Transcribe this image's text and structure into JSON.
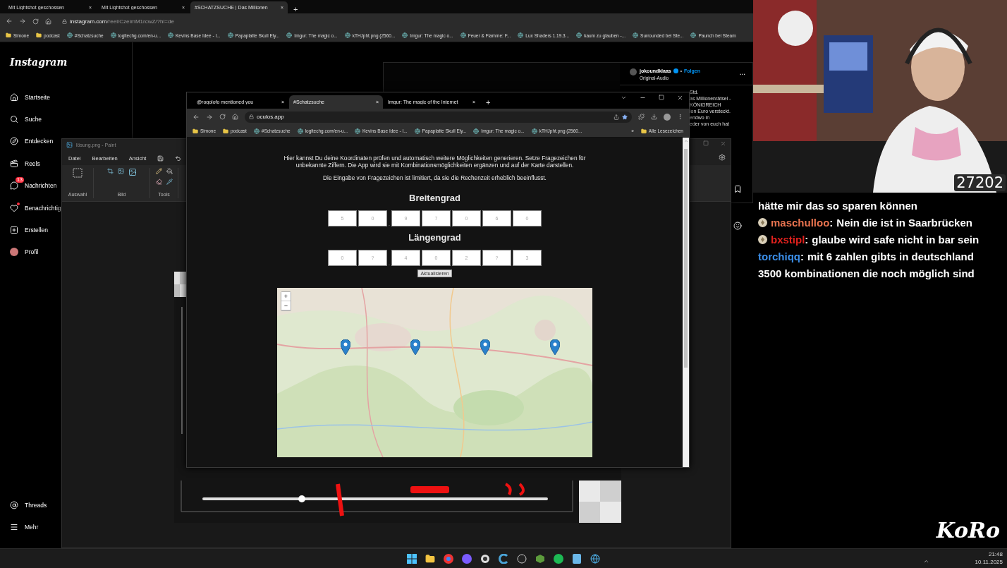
{
  "browser": {
    "tabs": [
      {
        "label": "Mit Lightshot geschossen",
        "close": "×",
        "selected": false
      },
      {
        "label": "Mit Lightshot geschossen",
        "close": "×",
        "selected": false
      },
      {
        "label": "#SCHATZSUCHE | Das Millionen",
        "close": "×",
        "selected": true
      }
    ],
    "new_tab": "+",
    "url_host": "instagram.com",
    "url_path": "/reel/CzeimM1rcwZ/?hl=de",
    "bookmarks": [
      "Simone",
      "podcast",
      "#Schatzsuche",
      "logitechg.com/en-u...",
      "Kevins Base Idee - I...",
      "Papaplatte Skull Ely...",
      "Imgur: The magic o...",
      "kTHJpht.png (2560...",
      "Imgur: The magic o...",
      "Feuer & Flamme: F...",
      "Lux Shaders 1.19.3...",
      "kaum zu glauben -...",
      "Surrounded bei Ste...",
      "Paunch bei Steam"
    ]
  },
  "instagram": {
    "logo": "Instagram",
    "nav": [
      {
        "label": "Startseite"
      },
      {
        "label": "Suche"
      },
      {
        "label": "Entdecken"
      },
      {
        "label": "Reels"
      },
      {
        "label": "Nachrichten",
        "badge": "13"
      },
      {
        "label": "Benachrichtig",
        "dot": true
      },
      {
        "label": "Erstellen"
      },
      {
        "label": "Profil"
      }
    ],
    "nav_bottom": [
      {
        "label": "Threads"
      },
      {
        "label": "Mehr"
      }
    ],
    "post": {
      "account": "jokoundklaas",
      "separator": "•",
      "follow": "Folgen",
      "audio": "Original-Audio",
      "more": "...",
      "caption_lines": [
        "Std.",
        "as Millionenrätsel -",
        "KÖNIGREICH",
        "ion Euro versteckt.",
        "endwo in",
        "eder von euch hat"
      ]
    }
  },
  "paint": {
    "title": "lösung.png - Paint",
    "menu": [
      "Datei",
      "Bearbeiten",
      "Ansicht"
    ],
    "groups": [
      "Auswahl",
      "Bild",
      "Tools"
    ]
  },
  "inner_browser": {
    "tabs": [
      {
        "label": "@rogolofo mentioned you",
        "close": "×",
        "selected": false
      },
      {
        "label": "#Schatzsuche",
        "close": "×",
        "selected": true
      },
      {
        "label": "Imgur: The magic of the Internet",
        "close": "×",
        "selected": false
      }
    ],
    "new_tab": "+",
    "url": "oculos.app",
    "bookmarks": [
      "Simone",
      "podcast",
      "#Schatzsuche",
      "logitechg.com/en-u...",
      "Kevins Base Idee - I...",
      "Papaplatte Skull Ely...",
      "Imgur: The magic o...",
      "kTHJpht.png (2560..."
    ],
    "more_bookmarks": "»",
    "all_bookmarks": "Alle Lesezeichen"
  },
  "page": {
    "intro": "Hier kannst Du deine Koordinaten prüfen und automatisch weitere Möglichkeiten generieren. Setze Fragezeichen für unbekannte Ziffern. Die App wird sie mit Kombinationsmöglichkeiten ergänzen und auf der Karte darstellen.",
    "note": "Die Eingabe von Fragezeichen ist limitiert, da sie die Rechenzeit erheblich beeinflusst.",
    "coordinates": [
      {
        "heading": "Breitengrad",
        "digits": [
          "5",
          "0",
          "9",
          "7",
          "0",
          "6",
          "0"
        ],
        "separator": "."
      },
      {
        "heading": "Längengrad",
        "digits": [
          "0",
          "?",
          "4",
          "0",
          "2",
          "?",
          "3"
        ],
        "separator": "."
      }
    ],
    "update_button": "Aktualisieren",
    "map": {
      "zoom_in": "+",
      "zoom_out": "−"
    }
  },
  "stream": {
    "counter": "27202",
    "logo": "KoRo",
    "chat": [
      {
        "kind": "continuation",
        "text": "hätte mir das so sparen können"
      },
      {
        "kind": "message",
        "user": "maschulloo",
        "separator": ":",
        "color": "#e8734f",
        "badge": true,
        "text": "Nein die ist in Saarbrücken"
      },
      {
        "kind": "message",
        "user": "bxstipl",
        "separator": ":",
        "color": "#e0211d",
        "badge": true,
        "text": "glaube wird safe nicht in bar sein"
      },
      {
        "kind": "message",
        "user": "torchiqq",
        "separator": ":",
        "color": "#3b8ee8",
        "badge": false,
        "text": "mit 6 zahlen gibts in deutschland"
      },
      {
        "kind": "continuation",
        "text": "3500 kombinationen die noch möglich sind"
      }
    ]
  },
  "taskbar": {
    "time": "21:48",
    "date": "10.11.2025"
  }
}
